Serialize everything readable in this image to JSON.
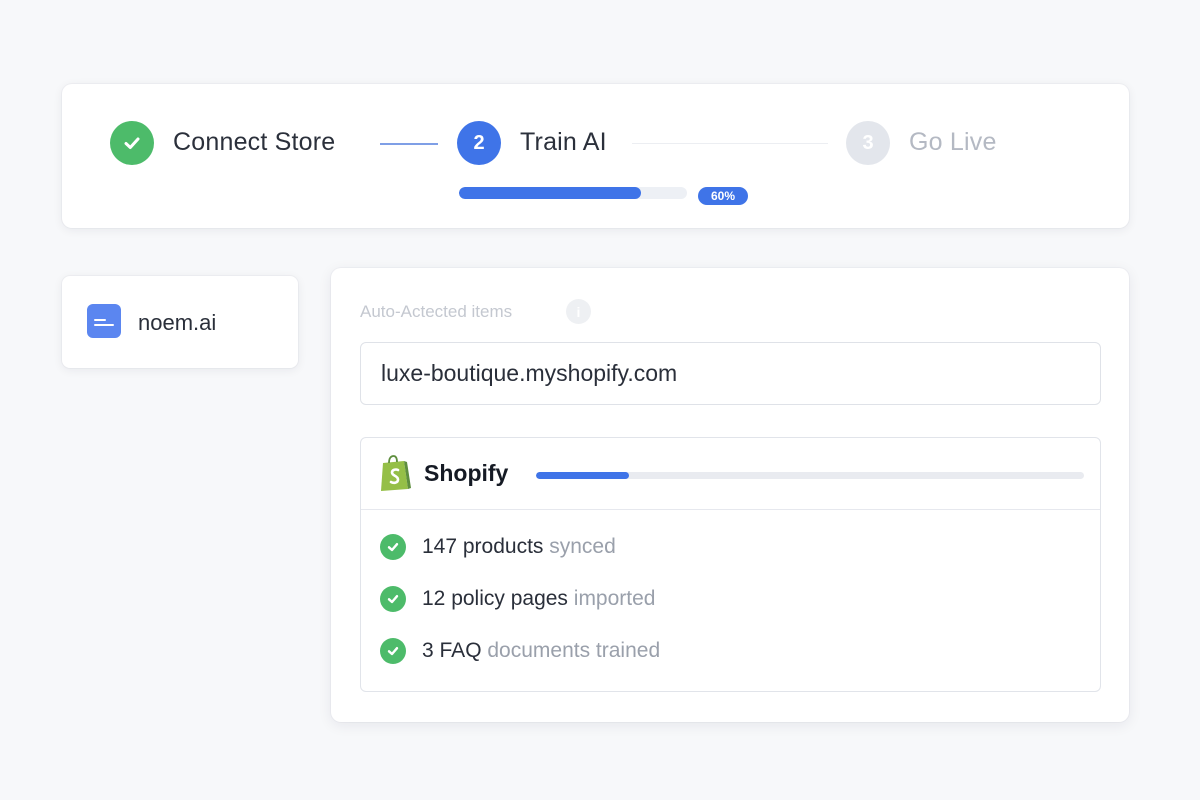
{
  "stepper": {
    "steps": [
      {
        "number": "",
        "label": "Connect Store",
        "state": "done"
      },
      {
        "number": "2",
        "label": "Train AI",
        "state": "active"
      },
      {
        "number": "3",
        "label": "Go Live",
        "state": "pending"
      }
    ],
    "progress_percent": 80,
    "progress_label": "60%"
  },
  "brand": {
    "name": "noem.ai"
  },
  "store_panel": {
    "section_label": "Auto-Actected items",
    "info_icon": "i",
    "store_url": "luxe-boutique.myshopify.com",
    "platform": {
      "name": "Shopify",
      "icon": "shopify-bag-icon",
      "sync_progress_percent": 17
    },
    "items": [
      {
        "strong": "147 products",
        "muted": " synced"
      },
      {
        "strong": "12 policy pages",
        "muted": " imported"
      },
      {
        "strong": "3 FAQ",
        "muted": " documents trained"
      }
    ]
  },
  "colors": {
    "accent": "#3f74e8",
    "success": "#4dbb6a",
    "pending": "#e3e6ec",
    "shopify_green": "#95bf47"
  }
}
